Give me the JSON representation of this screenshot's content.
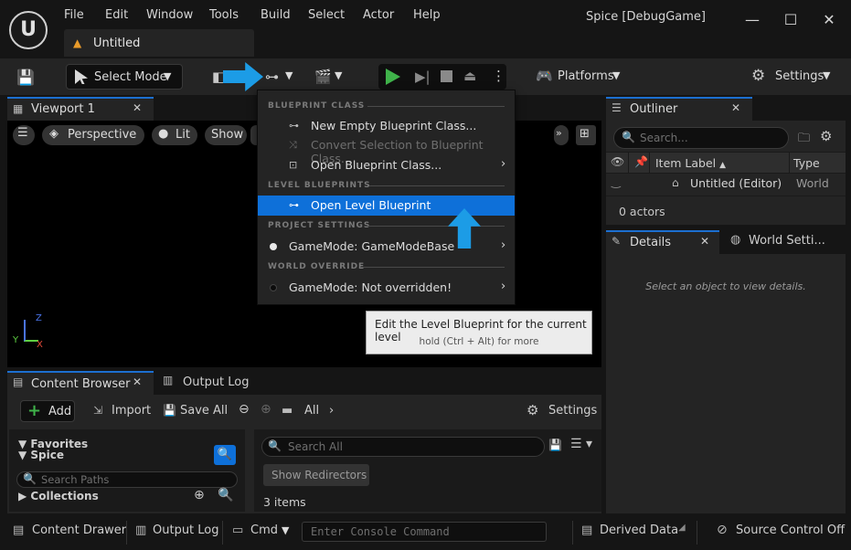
{
  "menubar": {
    "logo": "U",
    "items": [
      "File",
      "Edit",
      "Window",
      "Tools",
      "Build",
      "Select",
      "Actor",
      "Help"
    ],
    "project_name": "Spice [DebugGame]",
    "window_controls": {
      "minimize": "—",
      "maximize": "☐",
      "close": "✕"
    }
  },
  "document_tab": {
    "label": "Untitled",
    "icon": "level-warning-icon"
  },
  "toolbar": {
    "select_mode": "Select Mode",
    "platforms": "Platforms",
    "settings": "Settings",
    "chevron": "⌄"
  },
  "viewport": {
    "tab_label": "Viewport 1",
    "perspective": "Perspective",
    "lit": "Lit",
    "show": "Show",
    "axis": {
      "z": "Z",
      "y": "Y",
      "x": "X"
    }
  },
  "dropdown": {
    "sections": {
      "blueprint_class": "BLUEPRINT CLASS",
      "level_blueprints": "LEVEL BLUEPRINTS",
      "project_settings": "PROJECT SETTINGS",
      "world_override": "WORLD OVERRIDE"
    },
    "items": {
      "new_empty": "New Empty Blueprint Class...",
      "convert": "Convert Selection to Blueprint Class...",
      "open_class": "Open Blueprint Class...",
      "open_level": "Open Level Blueprint",
      "gamemode_project": "GameMode: GameModeBase",
      "gamemode_world": "GameMode: Not overridden!"
    },
    "submenu_arrow": "›"
  },
  "tooltip": {
    "title": "Edit the Level Blueprint for the current level",
    "hint": "hold (Ctrl + Alt) for more"
  },
  "outliner": {
    "tab_label": "Outliner",
    "search_placeholder": "Search...",
    "columns": {
      "item_label": "Item Label",
      "sort": "▲",
      "type": "Type"
    },
    "rows": [
      {
        "name": "Untitled (Editor)",
        "type": "World"
      }
    ],
    "count": "0 actors"
  },
  "details": {
    "tab_label": "Details",
    "world_settings_tab": "World Setti...",
    "empty_message": "Select an object to view details."
  },
  "content_browser": {
    "tab_label": "Content Browser",
    "output_log_tab": "Output Log",
    "add": "Add",
    "import": "Import",
    "save_all": "Save All",
    "path": "All",
    "settings": "Settings",
    "favorites": "Favorites",
    "spice": "Spice",
    "search_paths_placeholder": "Search Paths",
    "collections": "Collections",
    "search_all_placeholder": "Search All",
    "show_redirectors": "Show Redirectors",
    "item_count": "3 items"
  },
  "statusbar": {
    "content_drawer": "Content Drawer",
    "output_log": "Output Log",
    "cmd": "Cmd",
    "console_placeholder": "Enter Console Command",
    "derived_data": "Derived Data",
    "source_control": "Source Control Off"
  },
  "colors": {
    "accent": "#0e70d9",
    "annotation_arrow": "#1c9ce6",
    "play": "#3fb24a"
  }
}
